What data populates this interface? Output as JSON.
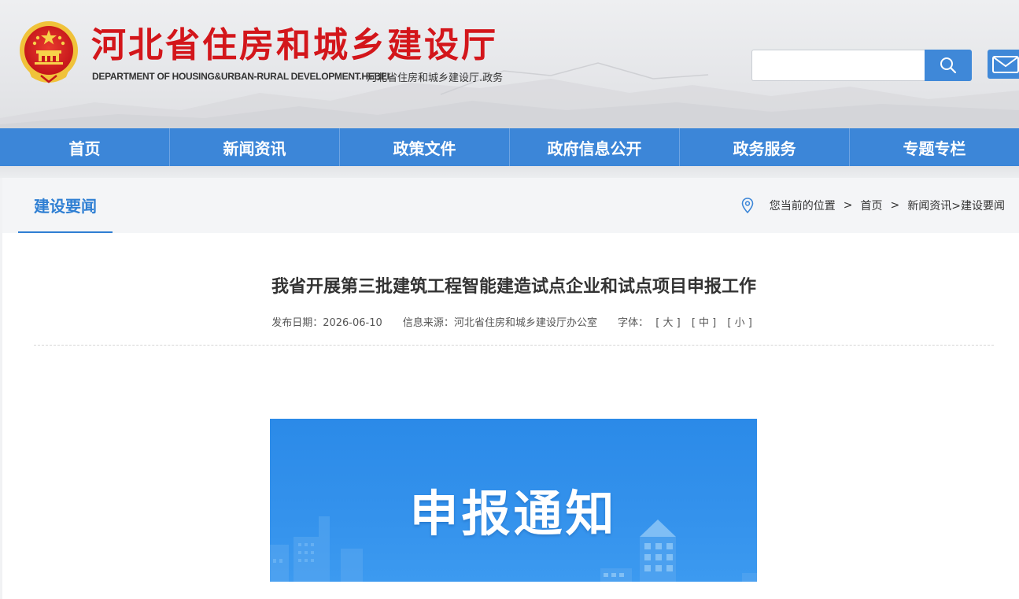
{
  "header": {
    "site_title": "河北省住房和城乡建设厅",
    "subtitle_en": "DEPARTMENT OF HOUSING&URBAN-RURAL DEVELOPMENT.HEBEI",
    "subtitle_cn": "河北省住房和城乡建设厅.政务",
    "search": {
      "value": "",
      "placeholder": ""
    }
  },
  "nav": {
    "items": [
      {
        "label": "首页"
      },
      {
        "label": "新闻资讯"
      },
      {
        "label": "政策文件"
      },
      {
        "label": "政府信息公开"
      },
      {
        "label": "政务服务"
      },
      {
        "label": "专题专栏"
      }
    ]
  },
  "section": {
    "tab_label": "建设要闻",
    "breadcrumb": {
      "prefix": "您当前的位置",
      "sep": ">",
      "home": "首页",
      "path": "新闻资讯>建设要闻"
    }
  },
  "article": {
    "title": "我省开展第三批建筑工程智能建造试点企业和试点项目申报工作",
    "publish_label": "发布日期：",
    "publish_date": "2026-06-10",
    "source_label": "信息来源：",
    "source": "河北省住房和城乡建设厅办公室",
    "font_label": "字体：",
    "font_large": "[ 大 ]",
    "font_medium": "[ 中 ]",
    "font_small": "[ 小 ]",
    "banner_text": "申报通知"
  },
  "colors": {
    "brand_red": "#d3161b",
    "nav_blue": "#3c86d8",
    "accent_blue": "#2f7fd3",
    "banner_blue": "#2b8ae8"
  },
  "icons": [
    "national-emblem-icon",
    "search-icon",
    "mail-icon",
    "location-pin-icon"
  ]
}
